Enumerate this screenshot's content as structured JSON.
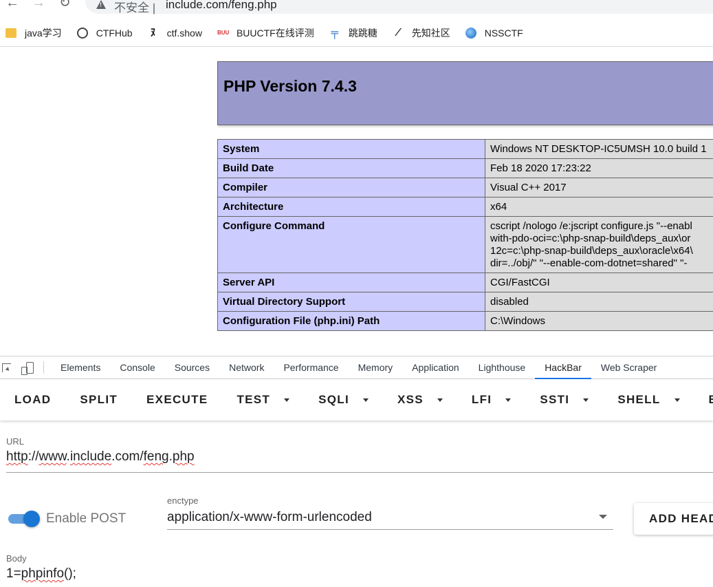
{
  "browser": {
    "security_label": "不安全 |",
    "address": "include.com/feng.php"
  },
  "bookmarks": [
    {
      "label": "java学习"
    },
    {
      "label": "CTFHub"
    },
    {
      "label": "ctf.show"
    },
    {
      "label": "BUUCTF在线评测"
    },
    {
      "label": "跳跳糖"
    },
    {
      "label": "先知社区"
    },
    {
      "label": "NSSCTF"
    }
  ],
  "phpinfo": {
    "title": "PHP Version 7.4.3",
    "rows": [
      {
        "key": "System",
        "value": [
          "Windows NT DESKTOP-IC5UMSH 10.0 build 1"
        ]
      },
      {
        "key": "Build Date",
        "value": [
          "Feb 18 2020 17:23:22"
        ]
      },
      {
        "key": "Compiler",
        "value": [
          "Visual C++ 2017"
        ]
      },
      {
        "key": "Architecture",
        "value": [
          "x64"
        ]
      },
      {
        "key": "Configure Command",
        "value": [
          "cscript /nologo /e:jscript configure.js \"--enabl",
          "with-pdo-oci=c:\\php-snap-build\\deps_aux\\or",
          "12c=c:\\php-snap-build\\deps_aux\\oracle\\x64\\",
          "dir=../obj/\" \"--enable-com-dotnet=shared\" \"-"
        ]
      },
      {
        "key": "Server API",
        "value": [
          "CGI/FastCGI"
        ]
      },
      {
        "key": "Virtual Directory Support",
        "value": [
          "disabled"
        ]
      },
      {
        "key": "Configuration File (php.ini) Path",
        "value": [
          "C:\\Windows"
        ]
      }
    ]
  },
  "devtools": {
    "tabs": [
      "Elements",
      "Console",
      "Sources",
      "Network",
      "Performance",
      "Memory",
      "Application",
      "Lighthouse",
      "HackBar",
      "Web Scraper"
    ],
    "active_tab": "HackBar"
  },
  "hackbar": {
    "toolbar": {
      "load": "LOAD",
      "split": "SPLIT",
      "execute": "EXECUTE",
      "test": "TEST",
      "sqli": "SQLI",
      "xss": "XSS",
      "lfi": "LFI",
      "ssti": "SSTI",
      "shell": "SHELL",
      "encoding": "EN"
    },
    "url_label": "URL",
    "url_parts": [
      "http",
      "://",
      "www",
      ".",
      "include",
      ".com/",
      "feng",
      ".",
      "php"
    ],
    "enable_post_label": "Enable POST",
    "enable_post": true,
    "enctype_label": "enctype",
    "enctype_value": "application/x-www-form-urlencoded",
    "add_header_label": "ADD HEAD",
    "body_label": "Body",
    "body_prefix": "1=",
    "body_func": "phpinfo",
    "body_suffix": "();"
  }
}
